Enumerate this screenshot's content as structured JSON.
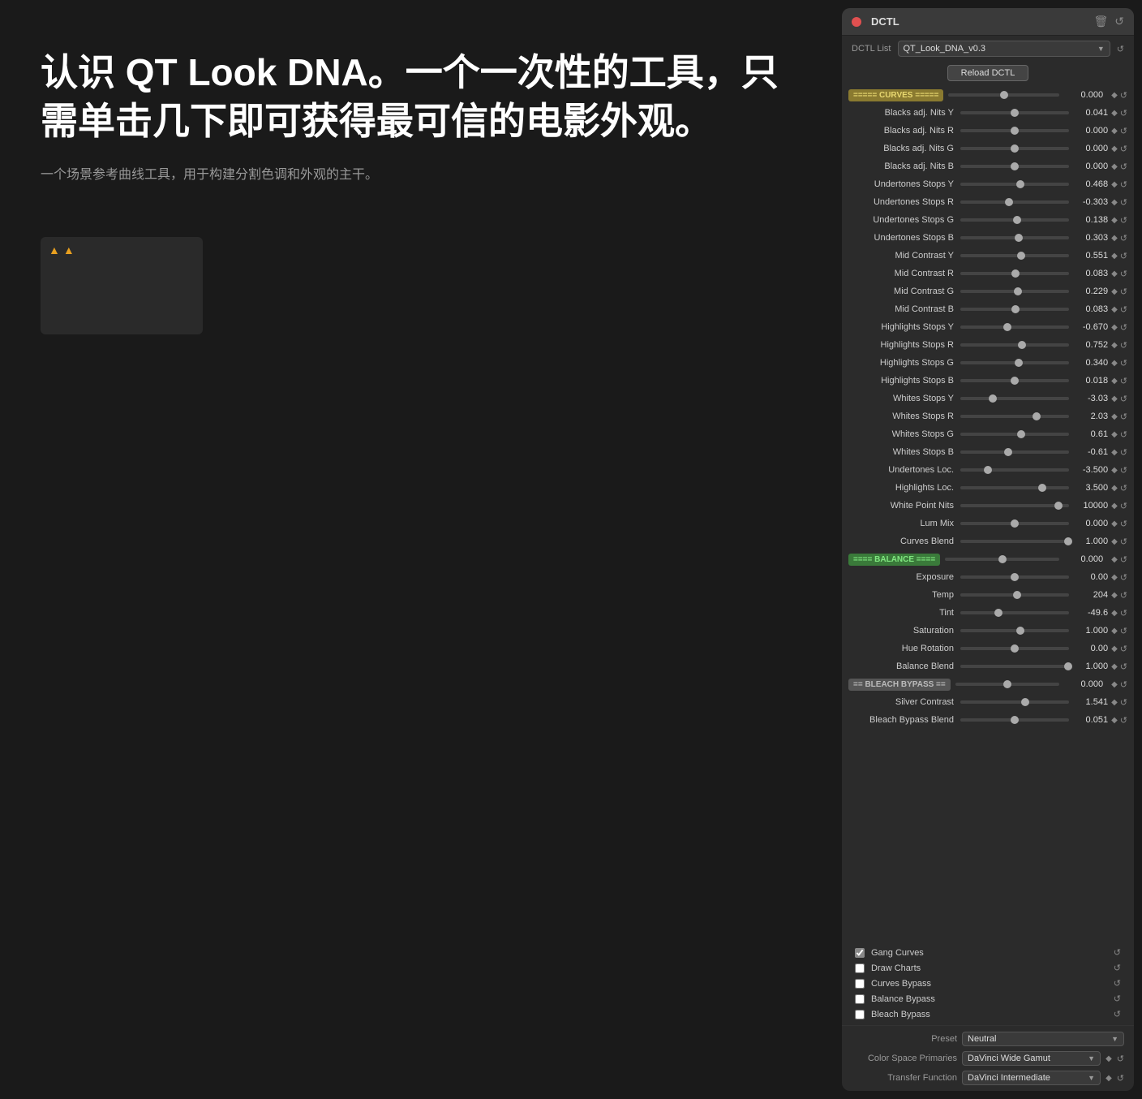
{
  "left": {
    "title": "认识 QT Look DNA。一个一次性的工具，只需单击几下即可获得最可信的电影外观。",
    "subtitle": "一个场景参考曲线工具，用于构建分割色调和外观的主干。"
  },
  "panel": {
    "title": "DCTL",
    "dctl_list_label": "DCTL List",
    "dctl_list_value": "QT_Look_DNA_v0.3",
    "reload_label": "Reload DCTL",
    "sections": {
      "curves_label": "===== CURVES =====",
      "balance_label": "==== BALANCE ====",
      "bleach_label": "== BLEACH BYPASS =="
    },
    "params": [
      {
        "label": "===== CURVES =====",
        "type": "header",
        "value": "0.000",
        "section": "curves"
      },
      {
        "label": "Blacks adj. Nits Y",
        "value": "0.041",
        "thumb": 0.5
      },
      {
        "label": "Blacks adj. Nits R",
        "value": "0.000",
        "thumb": 0.5
      },
      {
        "label": "Blacks adj. Nits G",
        "value": "0.000",
        "thumb": 0.5
      },
      {
        "label": "Blacks adj. Nits B",
        "value": "0.000",
        "thumb": 0.5
      },
      {
        "label": "Undertones Stops Y",
        "value": "0.468",
        "thumb": 0.55
      },
      {
        "label": "Undertones Stops R",
        "value": "-0.303",
        "thumb": 0.45
      },
      {
        "label": "Undertones Stops G",
        "value": "0.138",
        "thumb": 0.52
      },
      {
        "label": "Undertones Stops B",
        "value": "0.303",
        "thumb": 0.54
      },
      {
        "label": "Mid Contrast Y",
        "value": "0.551",
        "thumb": 0.56
      },
      {
        "label": "Mid Contrast R",
        "value": "0.083",
        "thumb": 0.51
      },
      {
        "label": "Mid Contrast G",
        "value": "0.229",
        "thumb": 0.53
      },
      {
        "label": "Mid Contrast B",
        "value": "0.083",
        "thumb": 0.51
      },
      {
        "label": "Highlights Stops Y",
        "value": "-0.670",
        "thumb": 0.43
      },
      {
        "label": "Highlights Stops R",
        "value": "0.752",
        "thumb": 0.57
      },
      {
        "label": "Highlights Stops G",
        "value": "0.340",
        "thumb": 0.54
      },
      {
        "label": "Highlights Stops B",
        "value": "0.018",
        "thumb": 0.5
      },
      {
        "label": "Whites Stops Y",
        "value": "-3.03",
        "thumb": 0.3
      },
      {
        "label": "Whites Stops R",
        "value": "2.03",
        "thumb": 0.7
      },
      {
        "label": "Whites Stops G",
        "value": "0.61",
        "thumb": 0.56
      },
      {
        "label": "Whites Stops B",
        "value": "-0.61",
        "thumb": 0.44
      },
      {
        "label": "Undertones Loc.",
        "value": "-3.500",
        "thumb": 0.25
      },
      {
        "label": "Highlights Loc.",
        "value": "3.500",
        "thumb": 0.75
      },
      {
        "label": "White Point Nits",
        "value": "10000",
        "thumb": 0.9
      },
      {
        "label": "Lum Mix",
        "value": "0.000",
        "thumb": 0.5
      },
      {
        "label": "Curves Blend",
        "value": "1.000",
        "thumb": 0.99
      },
      {
        "label": "==== BALANCE ====",
        "type": "header",
        "value": "0.000",
        "section": "balance"
      },
      {
        "label": "Exposure",
        "value": "0.00",
        "thumb": 0.5
      },
      {
        "label": "Temp",
        "value": "204",
        "thumb": 0.52
      },
      {
        "label": "Tint",
        "value": "-49.6",
        "thumb": 0.35
      },
      {
        "label": "Saturation",
        "value": "1.000",
        "thumb": 0.55
      },
      {
        "label": "Hue Rotation",
        "value": "0.00",
        "thumb": 0.5
      },
      {
        "label": "Balance Blend",
        "value": "1.000",
        "thumb": 0.99
      },
      {
        "label": "== BLEACH BYPASS ==",
        "type": "header",
        "value": "0.000",
        "section": "bleach"
      },
      {
        "label": "Silver Contrast",
        "value": "1.541",
        "thumb": 0.6
      },
      {
        "label": "Bleach Bypass Blend",
        "value": "0.051",
        "thumb": 0.5
      }
    ],
    "options": [
      {
        "label": "Gang Curves",
        "checked": true
      },
      {
        "label": "Draw Charts",
        "checked": false
      },
      {
        "label": "Curves Bypass",
        "checked": false
      },
      {
        "label": "Balance Bypass",
        "checked": false
      },
      {
        "label": "Bleach Bypass",
        "checked": false
      }
    ],
    "bottom": [
      {
        "label": "Preset",
        "value": "Neutral"
      },
      {
        "label": "Color Space Primaries",
        "value": "DaVinci Wide Gamut",
        "has_diamond": true
      },
      {
        "label": "Transfer Function",
        "value": "DaVinci Intermediate",
        "has_diamond": true
      }
    ]
  }
}
